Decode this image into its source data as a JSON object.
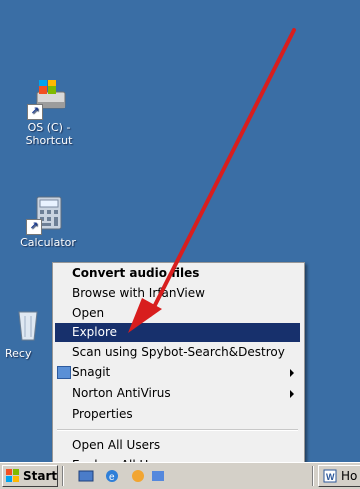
{
  "desktop": {
    "icons": [
      {
        "label": "OS (C) -\nShortcut",
        "icon": "drive-icon"
      },
      {
        "label": "Calculator",
        "icon": "calculator-icon"
      },
      {
        "label": "Recy",
        "icon": "recycle-bin-icon"
      }
    ]
  },
  "context_menu": {
    "items": [
      {
        "label": "Convert audio files",
        "bold": true
      },
      {
        "label": "Browse with IrfanView"
      },
      {
        "label": "Open"
      },
      {
        "label": "Explore",
        "selected": true
      },
      {
        "label": "Scan using Spybot-Search&Destroy"
      },
      {
        "label": "Snagit",
        "submenu": true,
        "icon": "snagit-icon"
      },
      {
        "label": "Norton AntiVirus",
        "submenu": true
      },
      {
        "label": "Properties"
      },
      {
        "label": "Open All Users"
      },
      {
        "label": "Explore All Users"
      }
    ]
  },
  "taskbar": {
    "start_label": "Start",
    "task_label": "Ho"
  },
  "colors": {
    "desktop": "#3a6ea5",
    "highlight": "#17306c",
    "arrow": "#d81e1e"
  }
}
